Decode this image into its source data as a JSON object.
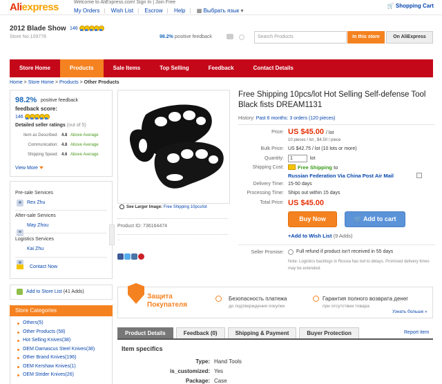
{
  "topbar": {
    "logo_main": "Ali",
    "logo_x": "express",
    "welcome": "Welcome to AliExpress.com! Sign In | Join Free",
    "nav": [
      "My Orders",
      "Wish List",
      "Escrow",
      "Help",
      "Выбрать язык"
    ],
    "cart": "Shopping Cart"
  },
  "store": {
    "name": "2012 Blade Show",
    "medal_count": "146",
    "number": "Store No.109778",
    "positive_pct": "98.2%",
    "positive_label": "positive feedback",
    "search_placeholder": "Search Products",
    "btn_in_store": "In this store",
    "btn_on_ali": "On AliExpress"
  },
  "storenav": [
    "Store Home",
    "Products",
    "Sale Items",
    "Top Selling",
    "Feedback",
    "Contact Details"
  ],
  "storenav_active": 1,
  "breadcrumb": {
    "items": [
      "Home",
      "Store Home",
      "Products"
    ],
    "current": "Other Products",
    "sep": ">"
  },
  "feedback": {
    "pct": "98.2%",
    "pct_label": "positive feedback",
    "score_label": "feedback score:",
    "score_value": "146",
    "ratings_title": "Detailed seller ratings",
    "ratings_sub": "(out of 5)",
    "ratings": [
      {
        "label": "Item as Described:",
        "value": "4.8",
        "avg": "Above Average"
      },
      {
        "label": "Communication:",
        "value": "4.8",
        "avg": "Above Average"
      },
      {
        "label": "Shipping Speed:",
        "value": "4.6",
        "avg": "Above Average"
      }
    ],
    "view_more": "View More"
  },
  "services": [
    {
      "title": "Pre-sale Services",
      "name": "Rex Zhu"
    },
    {
      "title": "After-sale Services",
      "name": "May Zhou"
    },
    {
      "title": "Logistics Services",
      "name": "Kai Zhu"
    }
  ],
  "contact_now": "Contact Now",
  "store_list": {
    "label": "Add to Store List",
    "count": "(41 Adds)"
  },
  "categories": {
    "header": "Store Categories",
    "items": [
      {
        "name": "Others",
        "count": "(5)"
      },
      {
        "name": "Other Products",
        "count": "(58)"
      },
      {
        "name": "Hot Selling Knives",
        "count": "(38)"
      },
      {
        "name": "OEM Damascus Steel Knives",
        "count": "(38)"
      },
      {
        "name": "Other Brand Knives",
        "count": "(196)"
      },
      {
        "name": "OEM Kershaw Knives",
        "count": "(1)"
      },
      {
        "name": "OEM Strider Knives",
        "count": "(26)"
      }
    ]
  },
  "image": {
    "see_larger": "See Larger Image:",
    "see_larger_link": "Free Shipping 10pcs/lot",
    "product_id_label": "Product ID:",
    "product_id": "736164474",
    "extra": "..."
  },
  "product": {
    "title": "Free Shipping 10pcs/lot Hot Selling Self-defense Tool Black fists DREAM1131",
    "history_label": "History:",
    "history_value": "Past 6 months: 3 orders (120 pieces)",
    "price_label": "Price:",
    "price": "US $45.00",
    "price_unit": "/ lot",
    "price_sub": "10 pieces / lot , $4.50 / piece",
    "bulk_label": "Bulk Price:",
    "bulk": "US $42.75 / lot (10 lots or more)",
    "qty_label": "Quantity:",
    "qty": "1",
    "qty_unit": "lot",
    "ship_label": "Shipping Cost:",
    "free_ship": "Free Shipping",
    "ship_to": "to",
    "ship_dest": "Russian Federation Via China Post Air Mail",
    "delivery_label": "Delivery Time:",
    "delivery": "15-50 days",
    "processing_label": "Processing Time:",
    "processing": "Ships out within 15 days",
    "total_label": "Total Price:",
    "total": "US $45.00",
    "buy_now": "Buy Now",
    "add_cart": "Add to cart",
    "wishlist": "+Add to Wish List",
    "wishlist_count": "(9 Adds)",
    "promise_label": "Seller Promise:",
    "promise": "Full refund if product isn't received in 55 days",
    "promise_note": "Note: Logistics backlogs in Russia has led to delays. Promised delivery times may be extended."
  },
  "protection": {
    "title": "Защита Покупателя",
    "h1": "Безопасность платежа",
    "s1": "до подтверждения покупки",
    "h2": "Гарантия полного возврата денег",
    "s2": "при отсутствии товара",
    "more": "Узнать больше »"
  },
  "tabs": [
    "Product Details",
    "Feedback (0)",
    "Shipping & Payment",
    "Buyer Protection"
  ],
  "tab_active": 0,
  "report": "Report item",
  "specs": {
    "title": "Item specifics",
    "rows": [
      {
        "k": "Type:",
        "v": "Hand Tools"
      },
      {
        "k": "is_customized:",
        "v": "Yes"
      },
      {
        "k": "Package:",
        "v": "Case"
      }
    ]
  },
  "colors": {
    "brand_red": "#c4081a",
    "accent_orange": "#f58220",
    "price_red": "#e62e04",
    "link_blue": "#0645ad",
    "free_green": "#3a9a17"
  }
}
